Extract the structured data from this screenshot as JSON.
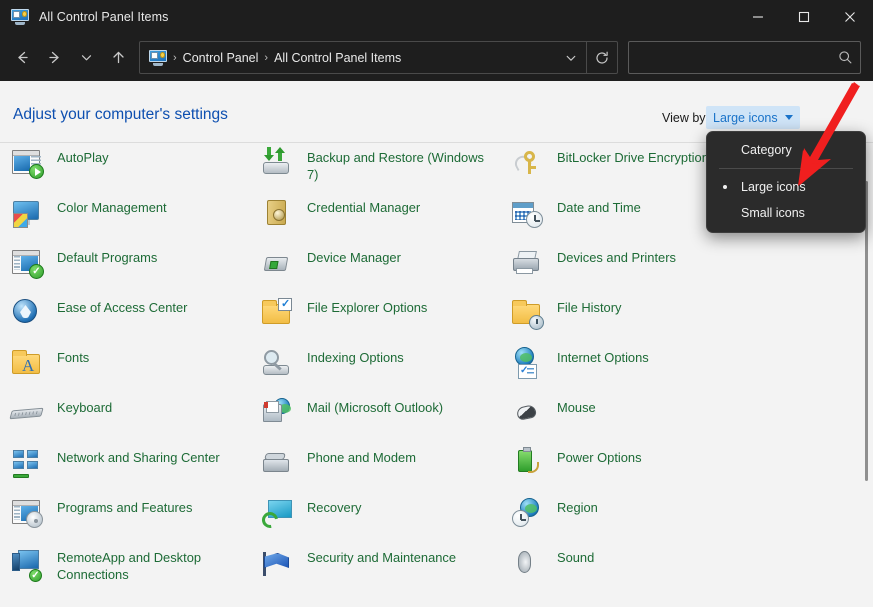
{
  "window": {
    "title": "All Control Panel Items",
    "title_icon": "control-panel-icon",
    "minimize_label": "Minimize",
    "maximize_label": "Maximize",
    "close_label": "Close"
  },
  "nav": {
    "back_label": "Back",
    "forward_label": "Forward",
    "recent_label": "Recent locations",
    "up_label": "Up",
    "refresh_label": "Refresh",
    "address_dropdown_label": "Previous locations",
    "breadcrumbs": [
      "Control Panel",
      "All Control Panel Items"
    ],
    "separator": "›"
  },
  "search": {
    "value": "",
    "placeholder": "",
    "icon": "search-icon"
  },
  "page": {
    "heading": "Adjust your computer's settings",
    "view_by_label": "View by:",
    "view_by_value": "Large icons"
  },
  "view_menu": {
    "items": [
      {
        "label": "Category",
        "selected": false
      },
      {
        "label": "Large icons",
        "selected": true
      },
      {
        "label": "Small icons",
        "selected": false
      }
    ]
  },
  "colors": {
    "titlebar_bg": "#1e1e1e",
    "content_bg": "#f3f3f3",
    "link_green": "#1d6b36",
    "heading_blue": "#0d4fb0",
    "viewby_accent": "#1a73c9",
    "viewby_bg": "#cfe4f7",
    "menu_bg": "#2b2b2b",
    "annotation_red": "#f01f1f"
  },
  "items": {
    "column1": [
      {
        "label": "AutoPlay",
        "icon": "autoplay-icon"
      },
      {
        "label": "Color Management",
        "icon": "color-management-icon"
      },
      {
        "label": "Default Programs",
        "icon": "default-programs-icon"
      },
      {
        "label": "Ease of Access Center",
        "icon": "ease-of-access-icon"
      },
      {
        "label": "Fonts",
        "icon": "fonts-icon"
      },
      {
        "label": "Keyboard",
        "icon": "keyboard-icon"
      },
      {
        "label": "Network and Sharing Center",
        "icon": "network-sharing-icon"
      },
      {
        "label": "Programs and Features",
        "icon": "programs-features-icon"
      },
      {
        "label": "RemoteApp and Desktop Connections",
        "icon": "remoteapp-icon"
      }
    ],
    "column2": [
      {
        "label": "Backup and Restore (Windows 7)",
        "icon": "backup-restore-icon"
      },
      {
        "label": "Credential Manager",
        "icon": "credential-manager-icon"
      },
      {
        "label": "Device Manager",
        "icon": "device-manager-icon"
      },
      {
        "label": "File Explorer Options",
        "icon": "file-explorer-options-icon"
      },
      {
        "label": "Indexing Options",
        "icon": "indexing-options-icon"
      },
      {
        "label": "Mail (Microsoft Outlook)",
        "icon": "mail-icon"
      },
      {
        "label": "Phone and Modem",
        "icon": "phone-modem-icon"
      },
      {
        "label": "Recovery",
        "icon": "recovery-icon"
      },
      {
        "label": "Security and Maintenance",
        "icon": "security-maintenance-icon"
      }
    ],
    "column3": [
      {
        "label": "BitLocker Drive Encryption",
        "icon": "bitlocker-icon"
      },
      {
        "label": "Date and Time",
        "icon": "date-time-icon"
      },
      {
        "label": "Devices and Printers",
        "icon": "devices-printers-icon"
      },
      {
        "label": "File History",
        "icon": "file-history-icon"
      },
      {
        "label": "Internet Options",
        "icon": "internet-options-icon"
      },
      {
        "label": "Mouse",
        "icon": "mouse-icon"
      },
      {
        "label": "Power Options",
        "icon": "power-options-icon"
      },
      {
        "label": "Region",
        "icon": "region-icon"
      },
      {
        "label": "Sound",
        "icon": "sound-icon"
      }
    ]
  }
}
